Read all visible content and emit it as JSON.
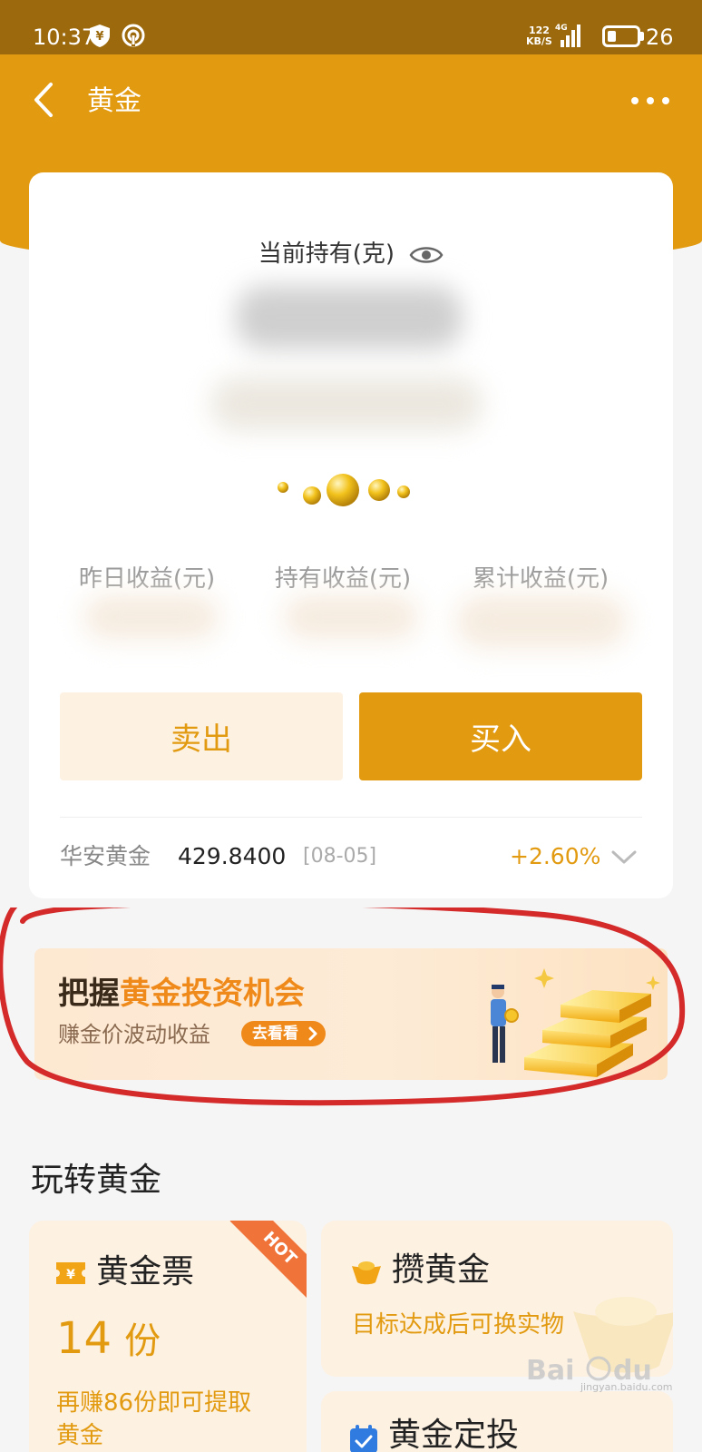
{
  "status_bar": {
    "time": "10:37",
    "net_speed_value": "122",
    "net_speed_unit": "KB/S",
    "network_type": "4G",
    "battery_level": "26"
  },
  "nav": {
    "title": "黄金",
    "back_icon": "chevron-left-icon",
    "more_icon": "more-dots-icon"
  },
  "holding": {
    "label": "当前持有(克)",
    "eye_icon": "eye-icon"
  },
  "earnings": {
    "yesterday_label": "昨日收益(元)",
    "holding_label": "持有收益(元)",
    "total_label": "累计收益(元)"
  },
  "actions": {
    "sell_label": "卖出",
    "buy_label": "买入"
  },
  "fund": {
    "name": "华安黄金",
    "price": "429.8400",
    "date": "[08-05]",
    "change": "+2.60%"
  },
  "banner": {
    "title_prefix": "把握",
    "title_highlight": "黄金投资机会",
    "subtitle": "赚金价波动收益",
    "button_label": "去看看"
  },
  "section": {
    "title": "玩转黄金"
  },
  "tiles": {
    "gold_ticket": {
      "title": "黄金票",
      "badge": "HOT",
      "count": "14",
      "unit": "份",
      "desc_line1": "再赚86份即可提取",
      "desc_line2": "黄金"
    },
    "save_gold": {
      "title": "攒黄金",
      "desc": "目标达成后可换实物"
    },
    "regular_invest": {
      "title": "黄金定投"
    }
  },
  "watermark": {
    "site": "jingyan.baidu.com"
  },
  "colors": {
    "brand": "#e29a10",
    "status_bar": "#9c6a0c",
    "banner_accent": "#ef8a1a",
    "annotation": "#d42a2a"
  }
}
